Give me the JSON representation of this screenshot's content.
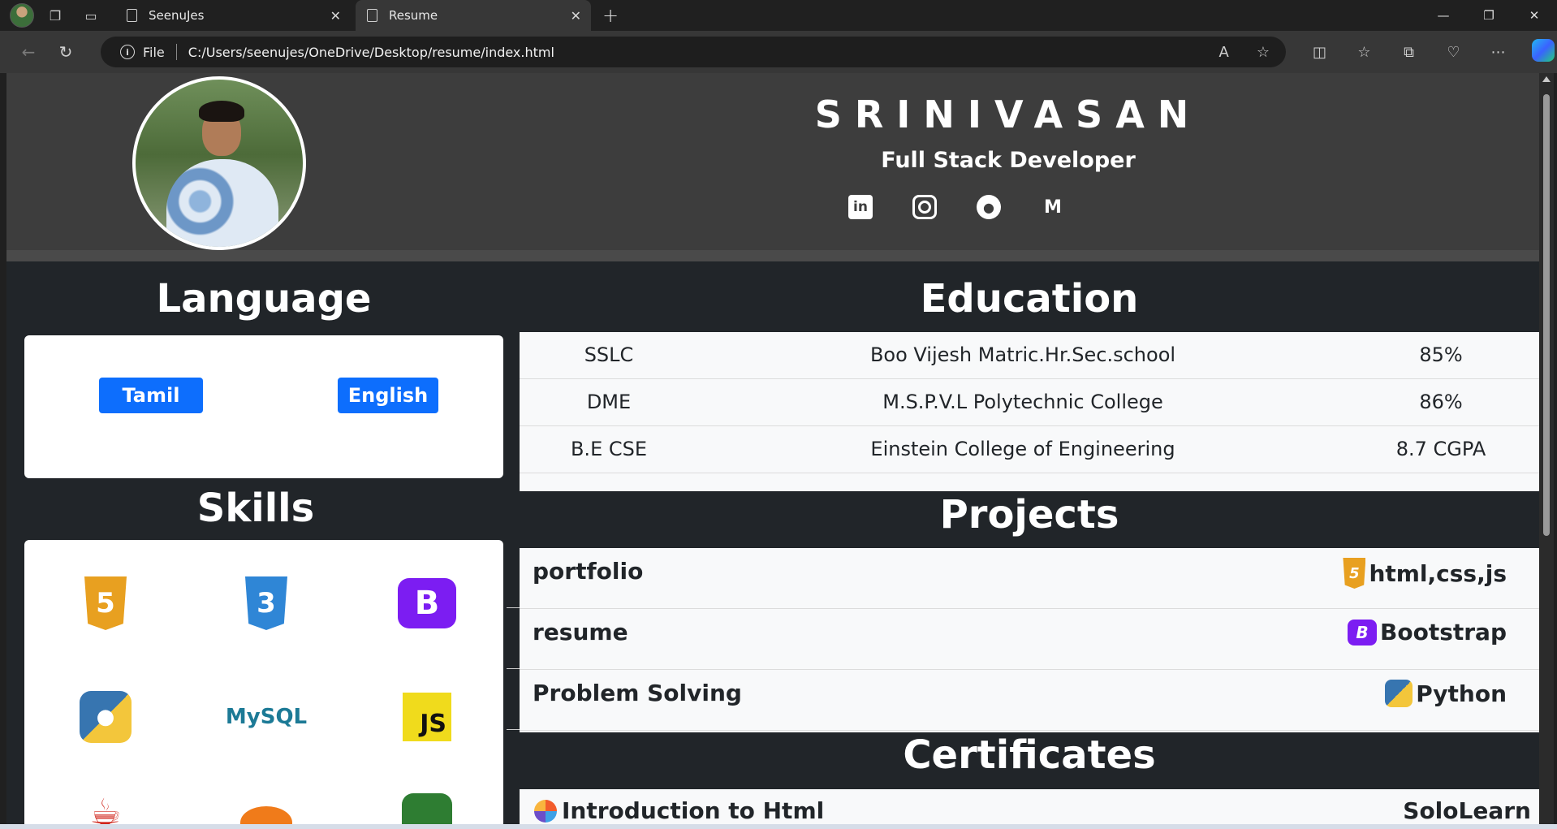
{
  "browser": {
    "tabs": [
      {
        "title": "SeenuJes"
      },
      {
        "title": "Resume"
      }
    ],
    "address": {
      "scheme_label": "File",
      "url": "C:/Users/seenujes/OneDrive/Desktop/resume/index.html"
    }
  },
  "header": {
    "name": "SRINIVASAN",
    "role": "Full Stack Developer",
    "socials": [
      "linkedin-icon",
      "instagram-icon",
      "github-icon",
      "gmail-icon"
    ]
  },
  "language": {
    "title": "Language",
    "items": [
      "Tamil",
      "English"
    ]
  },
  "skills": {
    "title": "Skills",
    "icons": [
      "html5-icon",
      "css3-icon",
      "bootstrap-icon",
      "python-icon",
      "mysql-icon",
      "javascript-icon",
      "java-icon",
      "blender-icon",
      "mongodb-icon"
    ],
    "mysql_label": "MySQL",
    "js_label": "JS"
  },
  "education": {
    "title": "Education",
    "rows": [
      {
        "level": "SSLC",
        "institution": "Boo Vijesh Matric.Hr.Sec.school",
        "score": "85%"
      },
      {
        "level": "DME",
        "institution": "M.S.P.V.L Polytechnic College",
        "score": "86%"
      },
      {
        "level": "B.E CSE",
        "institution": "Einstein College of Engineering",
        "score": "8.7 CGPA"
      }
    ]
  },
  "projects": {
    "title": "Projects",
    "rows": [
      {
        "name": "portfolio",
        "tech": "html,css,js"
      },
      {
        "name": "resume",
        "tech": "Bootstrap"
      },
      {
        "name": "Problem Solving",
        "tech": "Python"
      }
    ]
  },
  "certificates": {
    "title": "Certificates",
    "rows": [
      {
        "name": "Introduction to Html",
        "issuer": "SoloLearn"
      }
    ]
  }
}
